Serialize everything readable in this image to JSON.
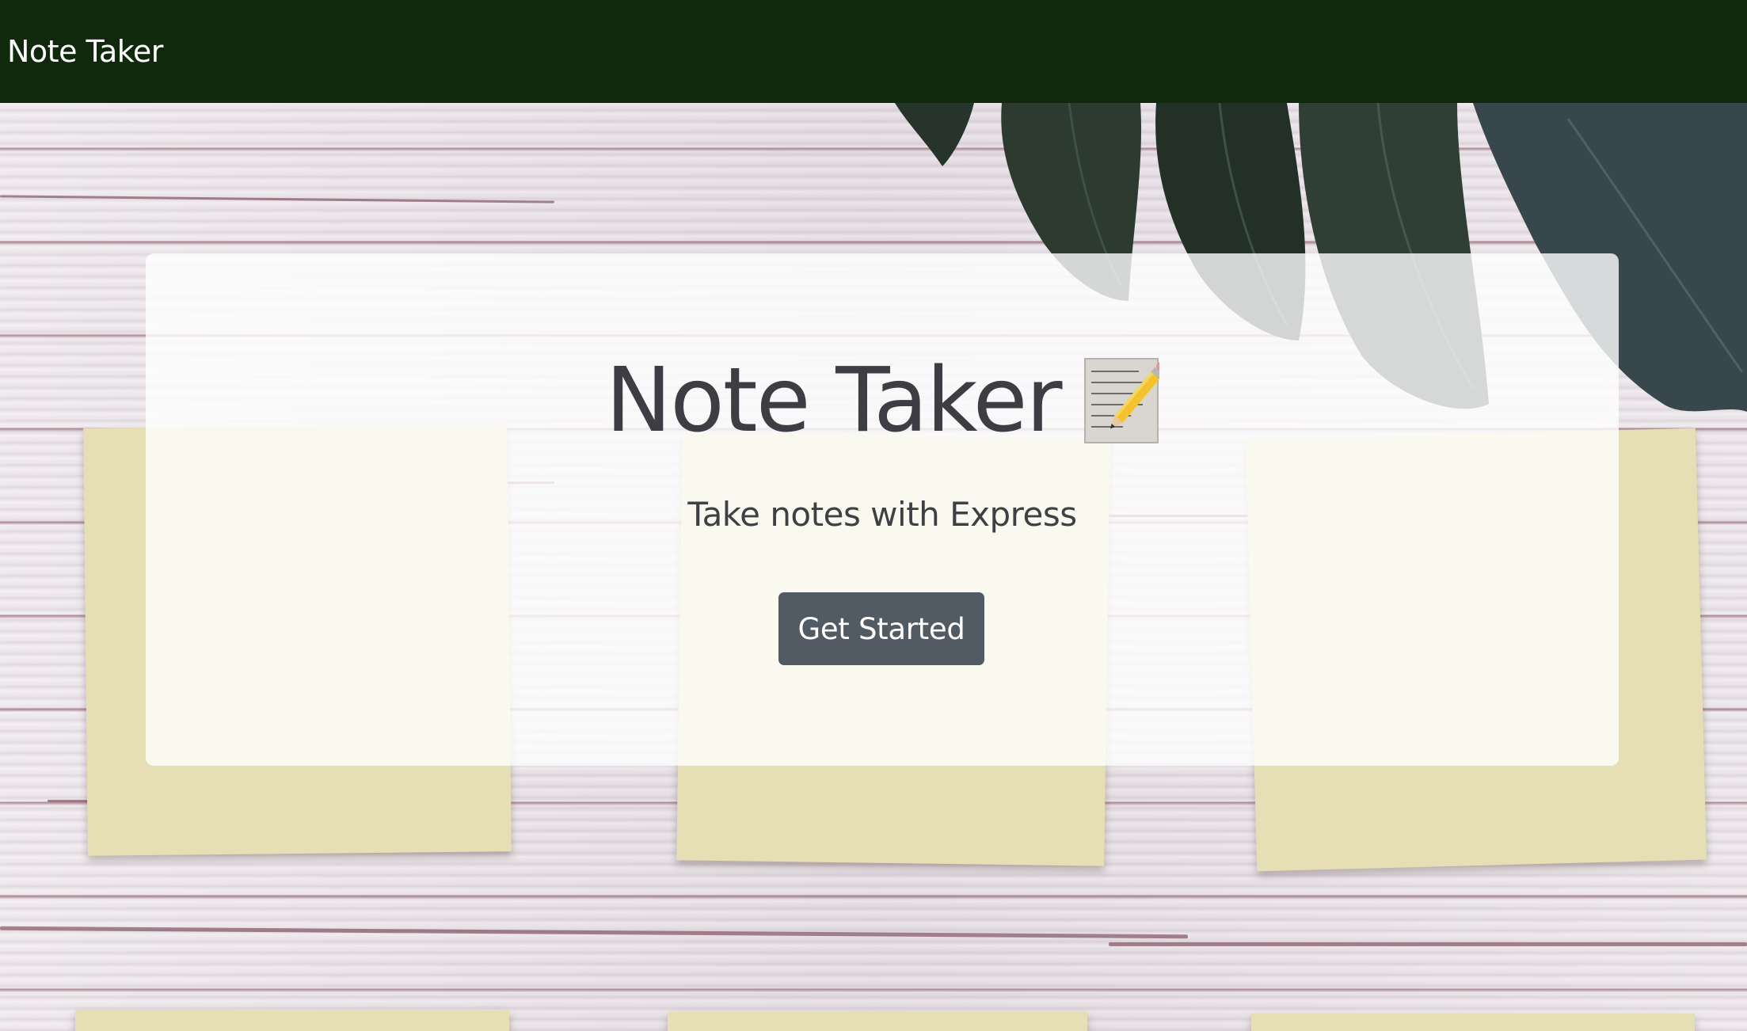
{
  "navbar": {
    "brand": "Note Taker"
  },
  "hero": {
    "title": "Note Taker",
    "title_icon": "memo-icon",
    "subtitle": "Take notes with Express",
    "cta_label": "Get Started"
  },
  "colors": {
    "navbar_bg": "#10290c",
    "button_bg": "#525a63",
    "sticky_note": "#e6dfb6"
  }
}
